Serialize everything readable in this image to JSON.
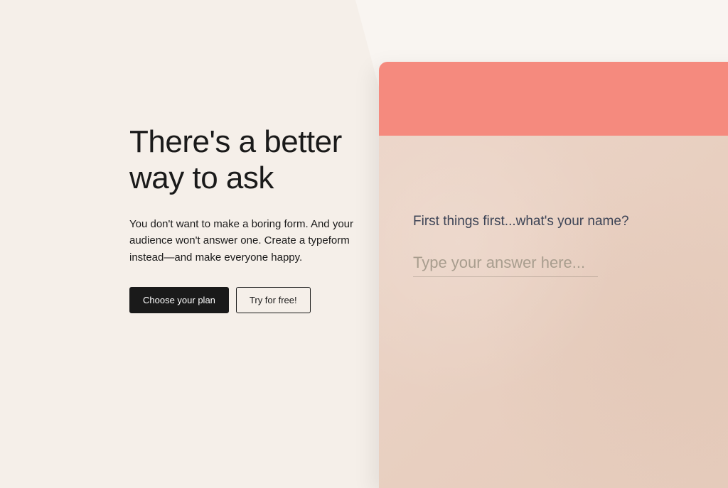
{
  "hero": {
    "headline": "There's a better way to ask",
    "body": "You don't want to make a boring form. And your audience won't answer one. Create a typeform instead—and make everyone happy.",
    "cta_primary": "Choose your plan",
    "cta_secondary": "Try for free!"
  },
  "form_preview": {
    "question": "First things first...what's your name?",
    "placeholder": "Type your answer here..."
  }
}
